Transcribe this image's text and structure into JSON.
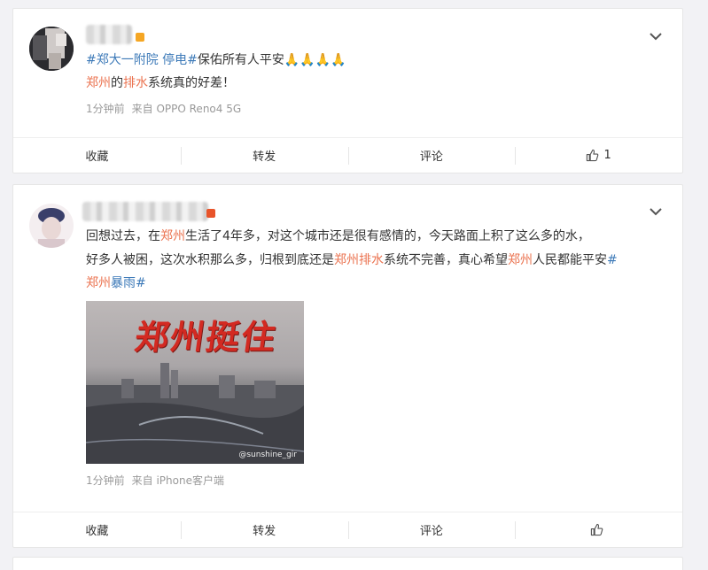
{
  "posts": [
    {
      "lines": [
        [
          {
            "t": "#郑大一附院 停电#",
            "c": "link"
          },
          {
            "t": "保佑所有人平安",
            "c": ""
          },
          {
            "t": "🙏🙏🙏🙏",
            "c": "emoji"
          }
        ],
        [
          {
            "t": "郑州",
            "c": "tag"
          },
          {
            "t": "的",
            "c": ""
          },
          {
            "t": "排水",
            "c": "tag"
          },
          {
            "t": "系统真的好差！",
            "c": ""
          }
        ]
      ],
      "time": "1分钟前",
      "source": "来自 OPPO Reno4 5G",
      "actions": {
        "favorite": "收藏",
        "repost": "转发",
        "comment": "评论",
        "like_count": "1"
      }
    },
    {
      "lines": [
        [
          {
            "t": "回想过去，在",
            "c": ""
          },
          {
            "t": "郑州",
            "c": "tag"
          },
          {
            "t": "生活了4年多，对这个城市还是很有感情的，今天路面上积了这么多的水，",
            "c": ""
          }
        ],
        [
          {
            "t": "好多人被困，这次水积那么多，归根到底还是",
            "c": ""
          },
          {
            "t": "郑州",
            "c": "tag"
          },
          {
            "t": "排水",
            "c": "tag"
          },
          {
            "t": "系统不完善，真心希望",
            "c": ""
          },
          {
            "t": "郑州",
            "c": "tag"
          },
          {
            "t": "人民都能平安",
            "c": ""
          },
          {
            "t": "#",
            "c": "link"
          }
        ],
        [
          {
            "t": "郑州",
            "c": "tag"
          },
          {
            "t": "暴雨",
            "c": "link"
          },
          {
            "t": "#",
            "c": "link"
          }
        ]
      ],
      "image": {
        "title": "郑州挺住",
        "watermark": "@sunshine_gir"
      },
      "time": "1分钟前",
      "source": "来自 iPhone客户端",
      "actions": {
        "favorite": "收藏",
        "repost": "转发",
        "comment": "评论",
        "like_count": ""
      }
    }
  ],
  "colors": {
    "link": "#3d7ab8",
    "tag": "#eb7350",
    "meta": "#999999",
    "badge1": "#f5a623",
    "badge2": "#e8542a"
  },
  "icons": {
    "menu": "chevron-down-icon",
    "like": "thumbs-up-icon"
  }
}
